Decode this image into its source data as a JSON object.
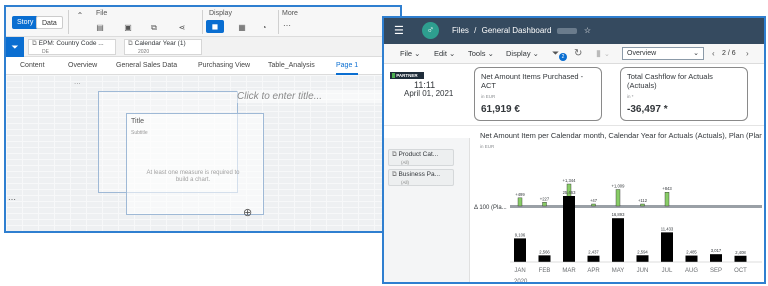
{
  "story": {
    "mode_buttons": [
      "Story",
      "Data"
    ],
    "toolbar_groups": [
      {
        "label": "File",
        "icons": [
          "save-icon",
          "copy-icon",
          "export-icon",
          "share-icon"
        ]
      },
      {
        "label": "Display",
        "icons": [
          "comment-icon",
          "grid-icon",
          "clock-icon"
        ]
      },
      {
        "label": "More",
        "icons": [
          "ellipsis-icon"
        ]
      }
    ],
    "filters": [
      {
        "label": "EPM: Country Code ...",
        "sub": "DE"
      },
      {
        "label": "Calendar Year (1)",
        "sub": "2020"
      }
    ],
    "tabs": [
      "Content",
      "Overview",
      "General Sales Data",
      "Purchasing View",
      "Table_Analysis",
      "Page 1"
    ],
    "active_tab": "Page 1",
    "title_placeholder": "Click to enter title...",
    "widget": {
      "title": "Title",
      "subtitle": "Subtitle",
      "message": "At least one measure is required to build a chart."
    },
    "side_dots": "..."
  },
  "dashboard": {
    "breadcrumb": [
      "Files",
      "General Dashboard"
    ],
    "breadcrumb_sep": "/",
    "menus": [
      "File",
      "Edit",
      "Tools",
      "Display"
    ],
    "toolbar_badge": "2",
    "page_select": "Overview",
    "page_indicator": "2 / 6",
    "partner_badge": "PARTNER",
    "time": "11:11",
    "date": "April 01, 2021",
    "kpis": [
      {
        "title": "Net Amount Items Purchased - ACT",
        "unit": "in EUR",
        "value": "61,919 €"
      },
      {
        "title": "Total Cashflow for Actuals (Actuals)",
        "unit": "in *",
        "value": "-36,497 *"
      }
    ],
    "side_filters": [
      {
        "label": "Product Cat...",
        "sub": "(All)"
      },
      {
        "label": "Business Pa...",
        "sub": "(All)"
      }
    ],
    "chart_title": "Net Amount Item per Calendar month, Calendar Year for Actuals (Actuals), Plan (Plan)...",
    "chart_unit": "in EUR"
  },
  "chart_data": {
    "type": "bar",
    "title": "Net Amount Item per Calendar month, Calendar Year for Actuals (Actuals), Plan (Plan)...",
    "categories": [
      "JAN",
      "FEB",
      "MAR",
      "APR",
      "MAY",
      "JUN",
      "JUL",
      "AUG",
      "SEP",
      "OCT"
    ],
    "x_group_label": "2020",
    "reference_label": "Δ 100 (Pla...",
    "series": [
      {
        "values": [
          9106,
          2566,
          25463,
          2437,
          16893,
          2594,
          11433,
          2485,
          3017,
          2408
        ]
      },
      {
        "values": [
          499,
          227,
          1344,
          47,
          1009,
          112,
          843,
          null,
          null,
          null
        ]
      }
    ],
    "colors": {
      "bars": "#000000",
      "variance": "#88cc66",
      "reference": "#9aa0a6"
    }
  }
}
